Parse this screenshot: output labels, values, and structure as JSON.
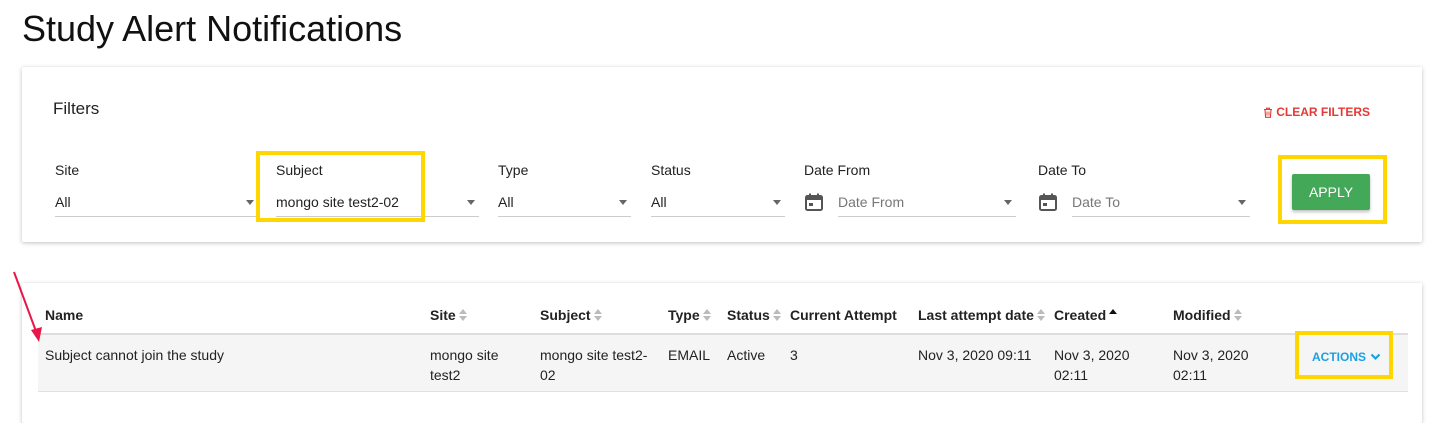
{
  "page": {
    "title": "Study Alert Notifications"
  },
  "filters": {
    "title": "Filters",
    "clear_label": "CLEAR FILTERS",
    "apply_label": "APPLY",
    "site": {
      "label": "Site",
      "value": "All"
    },
    "subject": {
      "label": "Subject",
      "value": "mongo site test2-02"
    },
    "type": {
      "label": "Type",
      "value": "All"
    },
    "status": {
      "label": "Status",
      "value": "All"
    },
    "date_from": {
      "label": "Date From",
      "placeholder": "Date From"
    },
    "date_to": {
      "label": "Date To",
      "placeholder": "Date To"
    }
  },
  "table": {
    "columns": [
      "Name",
      "Site",
      "Subject",
      "Type",
      "Status",
      "Current Attempt",
      "Last attempt date",
      "Created",
      "Modified"
    ],
    "rows": [
      {
        "name": "Subject cannot join the study",
        "site_l1": "mongo site",
        "site_l2": "test2",
        "subject_l1": "mongo site test2-",
        "subject_l2": "02",
        "type": "EMAIL",
        "status": "Active",
        "current_attempt": "3",
        "last_attempt": "Nov 3, 2020 09:11",
        "created_l1": "Nov 3, 2020",
        "created_l2": "02:11",
        "modified_l1": "Nov 3, 2020",
        "modified_l2": "02:11",
        "actions_label": "ACTIONS"
      }
    ]
  },
  "colors": {
    "accent_green": "#43a857",
    "danger_red": "#e53935",
    "link_blue": "#1ba0e2",
    "highlight_yellow": "#FFD600",
    "arrow_red": "#e8174a"
  },
  "icons": [
    "trash-icon",
    "calendar-icon",
    "chevron-down-icon",
    "sort-icon",
    "red-arrow"
  ]
}
